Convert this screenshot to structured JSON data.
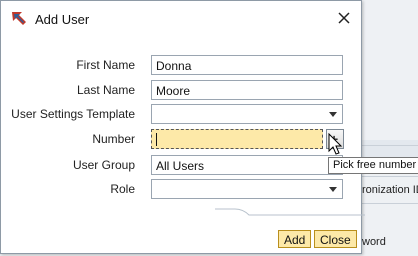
{
  "dialog": {
    "title": "Add User",
    "fields": [
      {
        "label": "First Name",
        "value": "Donna",
        "type": "text"
      },
      {
        "label": "Last Name",
        "value": "Moore",
        "type": "text"
      },
      {
        "label": "User Settings Template",
        "value": "",
        "type": "select"
      },
      {
        "label": "Number",
        "value": "",
        "type": "number"
      },
      {
        "label": "User Group",
        "value": "All Users",
        "type": "text"
      },
      {
        "label": "Role",
        "value": "",
        "type": "select"
      }
    ],
    "tooltip": "Pick free number",
    "buttons": {
      "add": "Add",
      "close": "Close"
    }
  },
  "background": {
    "partial_texts": [
      "ronization ID",
      "word"
    ]
  },
  "colors": {
    "button_fill": "#fde9a8",
    "button_border": "#b98f1d",
    "active_field": "#fde9a8",
    "title_icon_red": "#c0392b",
    "title_icon_blue": "#2f5f9a"
  },
  "icons": {
    "title": "add-user-icon",
    "close": "close-icon",
    "pick": "plus-icon",
    "cursor": "mouse-cursor-icon"
  }
}
